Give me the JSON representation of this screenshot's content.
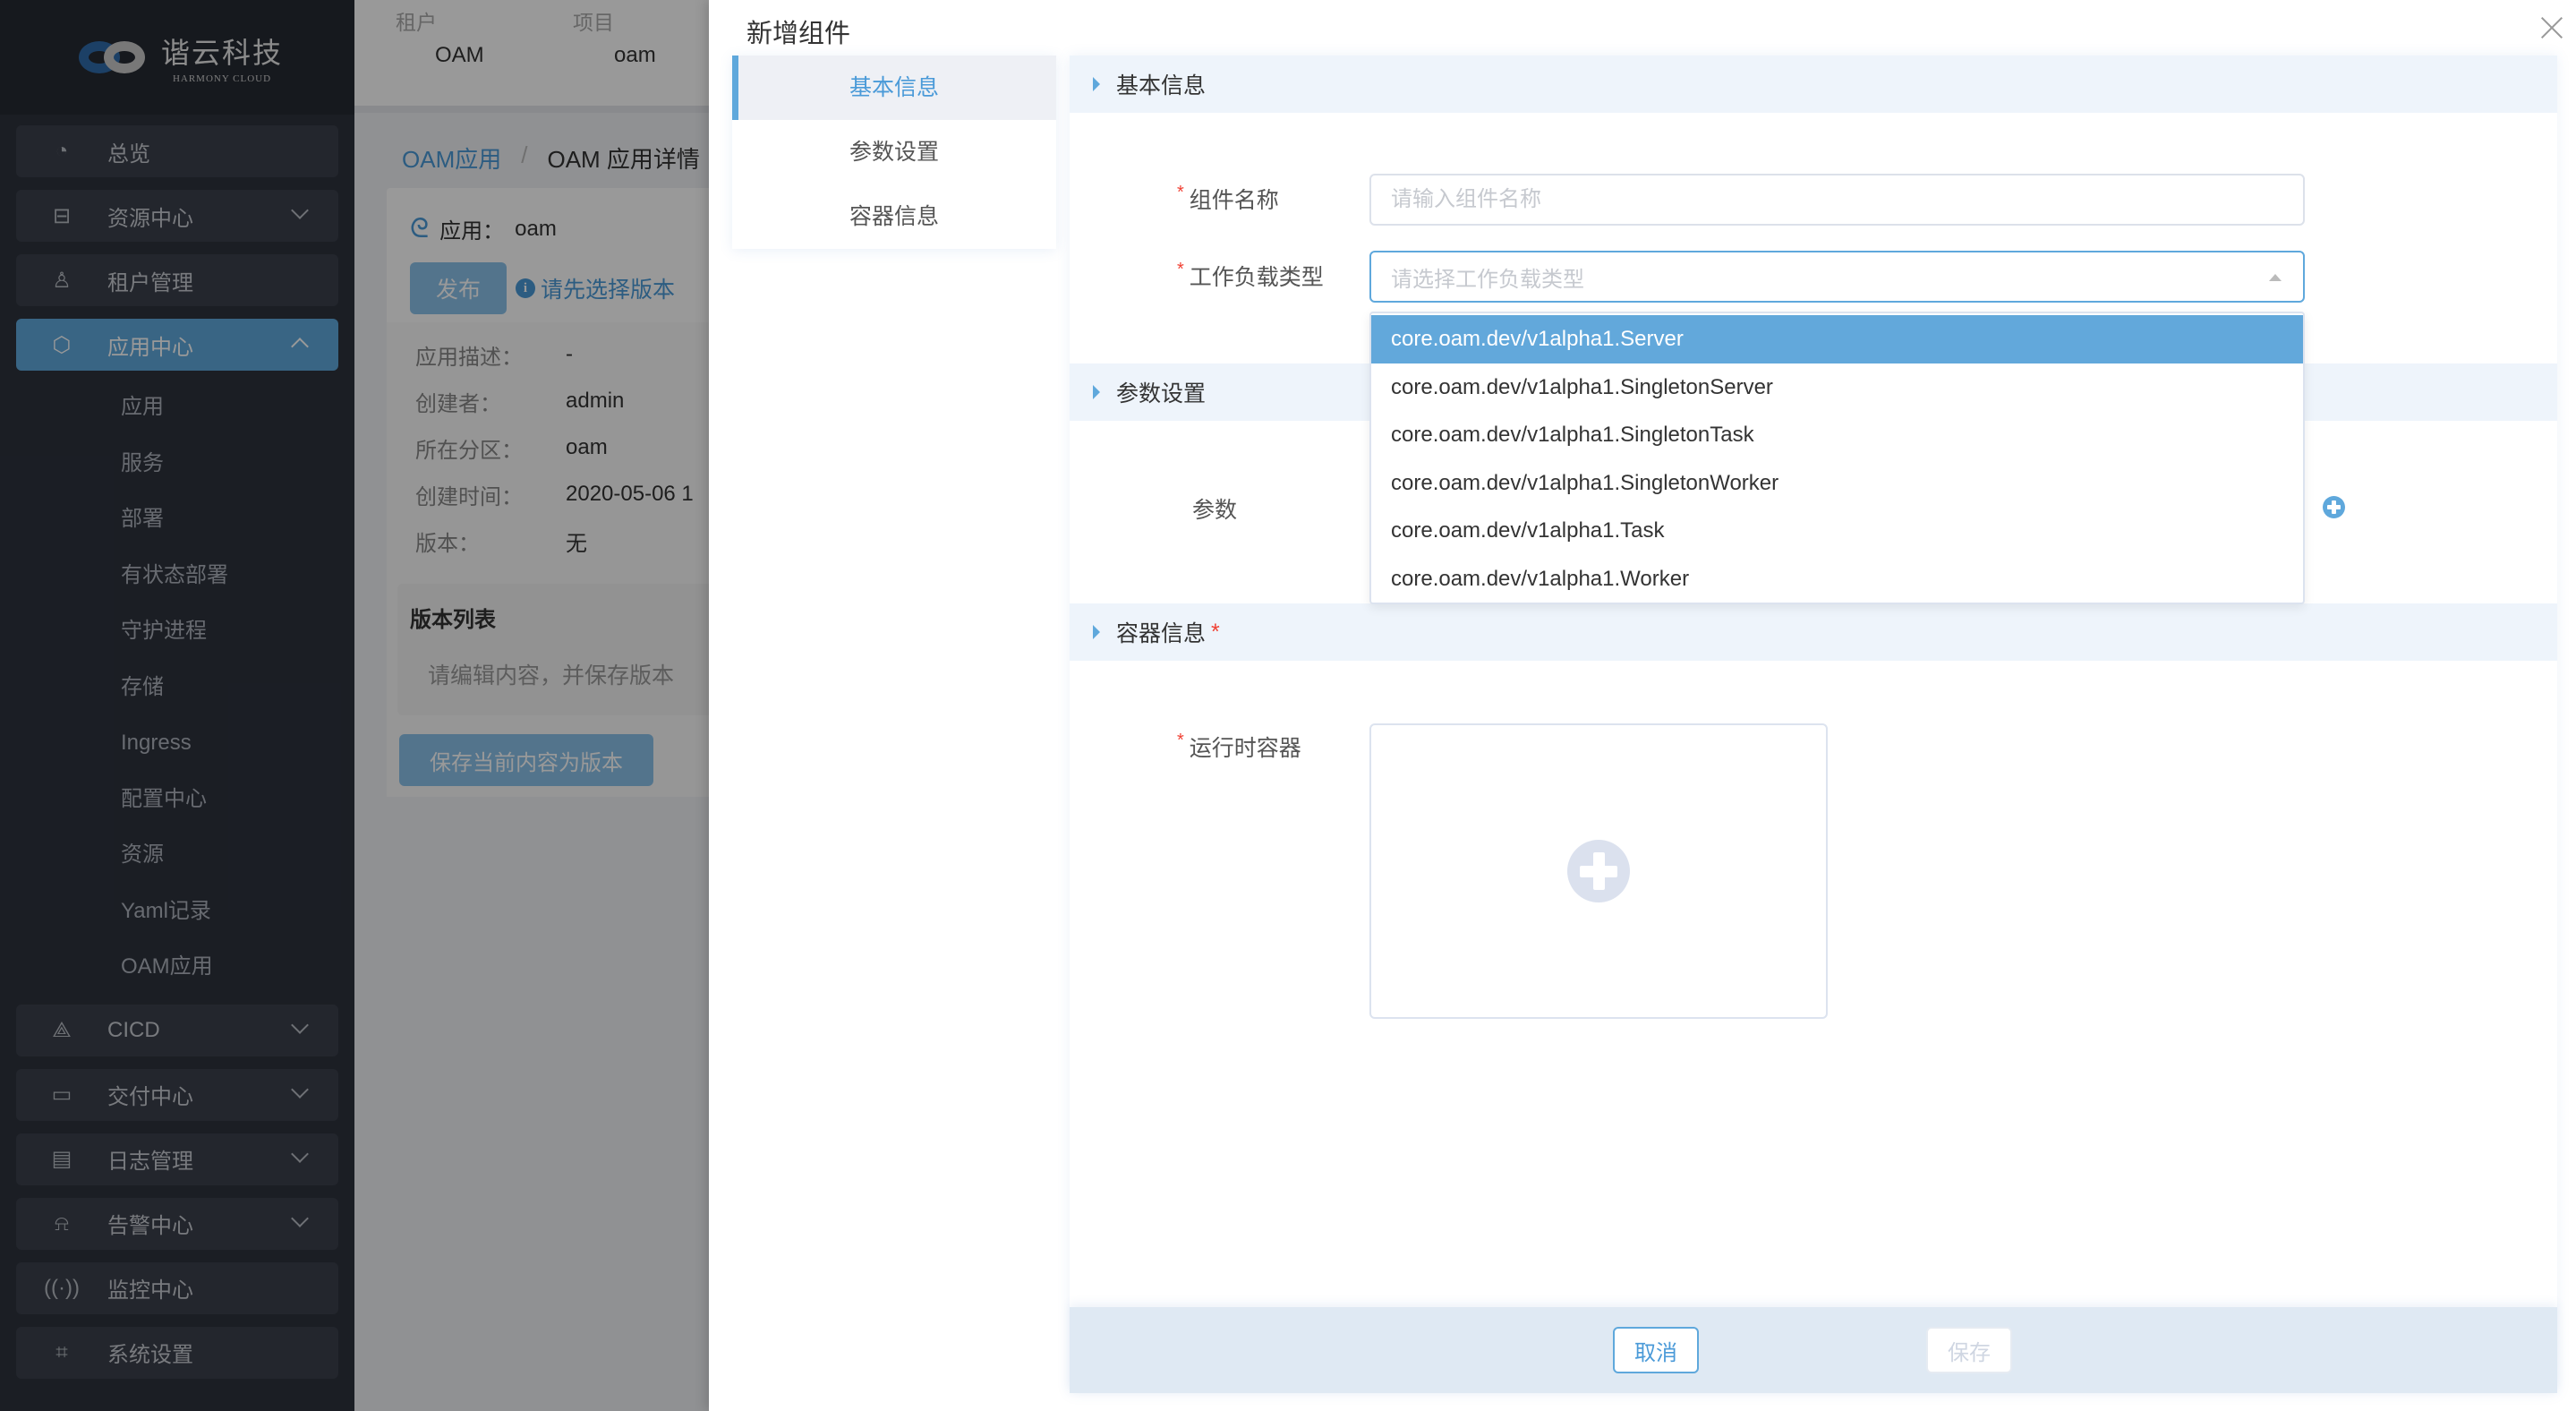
{
  "brand": {
    "name_cn": "谐云科技",
    "name_en": "HARMONY CLOUD"
  },
  "sidebar": {
    "items": [
      {
        "label": "总览",
        "icon": "pie-chart-icon",
        "expandable": false
      },
      {
        "label": "资源中心",
        "icon": "server-icon",
        "expandable": true
      },
      {
        "label": "租户管理",
        "icon": "tenant-icon",
        "expandable": false
      },
      {
        "label": "应用中心",
        "icon": "cube-icon",
        "expandable": true,
        "expanded": true,
        "active": true
      },
      {
        "label": "CICD",
        "icon": "pipeline-icon",
        "expandable": true
      },
      {
        "label": "交付中心",
        "icon": "monitor-icon",
        "expandable": true
      },
      {
        "label": "日志管理",
        "icon": "log-icon",
        "expandable": true
      },
      {
        "label": "告警中心",
        "icon": "bell-icon",
        "expandable": true
      },
      {
        "label": "监控中心",
        "icon": "signal-icon",
        "expandable": false
      },
      {
        "label": "系统设置",
        "icon": "settings-monitor-icon",
        "expandable": false
      }
    ],
    "submenu": [
      "应用",
      "服务",
      "部署",
      "有状态部署",
      "守护进程",
      "存储",
      "Ingress",
      "配置中心",
      "资源",
      "Yaml记录",
      "OAM应用"
    ]
  },
  "topbar": {
    "tenant_label": "租户",
    "tenant_value": "OAM",
    "project_label": "项目",
    "project_value": "oam"
  },
  "breadcrumb": {
    "parent": "OAM应用",
    "separator": "/",
    "current": "OAM 应用详情"
  },
  "app": {
    "title_label": "应用：",
    "title_value": "oam",
    "publish_button": "发布",
    "hint": "请先选择版本",
    "meta": [
      {
        "key": "应用描述：",
        "value": "-"
      },
      {
        "key": "创建者：",
        "value": "admin"
      },
      {
        "key": "所在分区：",
        "value": "oam"
      },
      {
        "key": "创建时间：",
        "value": "2020-05-06 1"
      },
      {
        "key": "版本：",
        "value": "无"
      }
    ],
    "versions_title": "版本列表",
    "versions_hint": "请编辑内容，并保存版本",
    "save_version_button": "保存当前内容为版本"
  },
  "drawer": {
    "title": "新增组件",
    "tabs": [
      {
        "label": "基本信息",
        "active": true
      },
      {
        "label": "参数设置",
        "active": false
      },
      {
        "label": "容器信息",
        "active": false
      }
    ],
    "sections": {
      "basic": "基本信息",
      "params": "参数设置",
      "container": "容器信息"
    },
    "fields": {
      "name_label": "组件名称",
      "name_placeholder": "请输入组件名称",
      "name_value": "",
      "workload_label": "工作负载类型",
      "workload_placeholder": "请选择工作负载类型",
      "params_label": "参数",
      "runtime_label": "运行时容器"
    },
    "workload_options": [
      "core.oam.dev/v1alpha1.Server",
      "core.oam.dev/v1alpha1.SingletonServer",
      "core.oam.dev/v1alpha1.SingletonTask",
      "core.oam.dev/v1alpha1.SingletonWorker",
      "core.oam.dev/v1alpha1.Task",
      "core.oam.dev/v1alpha1.Worker"
    ],
    "highlighted_option_index": 0,
    "footer": {
      "cancel": "取消",
      "save": "保存"
    }
  },
  "colors": {
    "accent": "#5fa8dc",
    "required": "#f04134",
    "sidebar_bg": "#2d323d"
  }
}
